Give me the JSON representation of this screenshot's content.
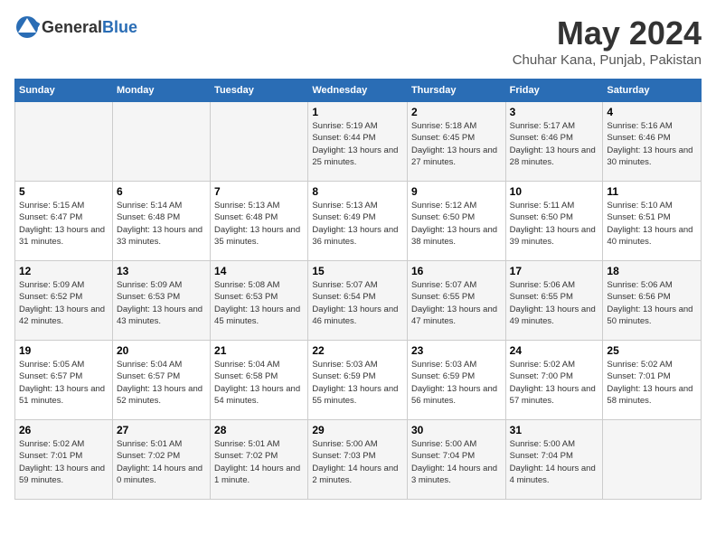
{
  "logo": {
    "general": "General",
    "blue": "Blue"
  },
  "header": {
    "month": "May 2024",
    "location": "Chuhar Kana, Punjab, Pakistan"
  },
  "weekdays": [
    "Sunday",
    "Monday",
    "Tuesday",
    "Wednesday",
    "Thursday",
    "Friday",
    "Saturday"
  ],
  "weeks": [
    [
      {
        "day": "",
        "sunrise": "",
        "sunset": "",
        "daylight": ""
      },
      {
        "day": "",
        "sunrise": "",
        "sunset": "",
        "daylight": ""
      },
      {
        "day": "",
        "sunrise": "",
        "sunset": "",
        "daylight": ""
      },
      {
        "day": "1",
        "sunrise": "Sunrise: 5:19 AM",
        "sunset": "Sunset: 6:44 PM",
        "daylight": "Daylight: 13 hours and 25 minutes."
      },
      {
        "day": "2",
        "sunrise": "Sunrise: 5:18 AM",
        "sunset": "Sunset: 6:45 PM",
        "daylight": "Daylight: 13 hours and 27 minutes."
      },
      {
        "day": "3",
        "sunrise": "Sunrise: 5:17 AM",
        "sunset": "Sunset: 6:46 PM",
        "daylight": "Daylight: 13 hours and 28 minutes."
      },
      {
        "day": "4",
        "sunrise": "Sunrise: 5:16 AM",
        "sunset": "Sunset: 6:46 PM",
        "daylight": "Daylight: 13 hours and 30 minutes."
      }
    ],
    [
      {
        "day": "5",
        "sunrise": "Sunrise: 5:15 AM",
        "sunset": "Sunset: 6:47 PM",
        "daylight": "Daylight: 13 hours and 31 minutes."
      },
      {
        "day": "6",
        "sunrise": "Sunrise: 5:14 AM",
        "sunset": "Sunset: 6:48 PM",
        "daylight": "Daylight: 13 hours and 33 minutes."
      },
      {
        "day": "7",
        "sunrise": "Sunrise: 5:13 AM",
        "sunset": "Sunset: 6:48 PM",
        "daylight": "Daylight: 13 hours and 35 minutes."
      },
      {
        "day": "8",
        "sunrise": "Sunrise: 5:13 AM",
        "sunset": "Sunset: 6:49 PM",
        "daylight": "Daylight: 13 hours and 36 minutes."
      },
      {
        "day": "9",
        "sunrise": "Sunrise: 5:12 AM",
        "sunset": "Sunset: 6:50 PM",
        "daylight": "Daylight: 13 hours and 38 minutes."
      },
      {
        "day": "10",
        "sunrise": "Sunrise: 5:11 AM",
        "sunset": "Sunset: 6:50 PM",
        "daylight": "Daylight: 13 hours and 39 minutes."
      },
      {
        "day": "11",
        "sunrise": "Sunrise: 5:10 AM",
        "sunset": "Sunset: 6:51 PM",
        "daylight": "Daylight: 13 hours and 40 minutes."
      }
    ],
    [
      {
        "day": "12",
        "sunrise": "Sunrise: 5:09 AM",
        "sunset": "Sunset: 6:52 PM",
        "daylight": "Daylight: 13 hours and 42 minutes."
      },
      {
        "day": "13",
        "sunrise": "Sunrise: 5:09 AM",
        "sunset": "Sunset: 6:53 PM",
        "daylight": "Daylight: 13 hours and 43 minutes."
      },
      {
        "day": "14",
        "sunrise": "Sunrise: 5:08 AM",
        "sunset": "Sunset: 6:53 PM",
        "daylight": "Daylight: 13 hours and 45 minutes."
      },
      {
        "day": "15",
        "sunrise": "Sunrise: 5:07 AM",
        "sunset": "Sunset: 6:54 PM",
        "daylight": "Daylight: 13 hours and 46 minutes."
      },
      {
        "day": "16",
        "sunrise": "Sunrise: 5:07 AM",
        "sunset": "Sunset: 6:55 PM",
        "daylight": "Daylight: 13 hours and 47 minutes."
      },
      {
        "day": "17",
        "sunrise": "Sunrise: 5:06 AM",
        "sunset": "Sunset: 6:55 PM",
        "daylight": "Daylight: 13 hours and 49 minutes."
      },
      {
        "day": "18",
        "sunrise": "Sunrise: 5:06 AM",
        "sunset": "Sunset: 6:56 PM",
        "daylight": "Daylight: 13 hours and 50 minutes."
      }
    ],
    [
      {
        "day": "19",
        "sunrise": "Sunrise: 5:05 AM",
        "sunset": "Sunset: 6:57 PM",
        "daylight": "Daylight: 13 hours and 51 minutes."
      },
      {
        "day": "20",
        "sunrise": "Sunrise: 5:04 AM",
        "sunset": "Sunset: 6:57 PM",
        "daylight": "Daylight: 13 hours and 52 minutes."
      },
      {
        "day": "21",
        "sunrise": "Sunrise: 5:04 AM",
        "sunset": "Sunset: 6:58 PM",
        "daylight": "Daylight: 13 hours and 54 minutes."
      },
      {
        "day": "22",
        "sunrise": "Sunrise: 5:03 AM",
        "sunset": "Sunset: 6:59 PM",
        "daylight": "Daylight: 13 hours and 55 minutes."
      },
      {
        "day": "23",
        "sunrise": "Sunrise: 5:03 AM",
        "sunset": "Sunset: 6:59 PM",
        "daylight": "Daylight: 13 hours and 56 minutes."
      },
      {
        "day": "24",
        "sunrise": "Sunrise: 5:02 AM",
        "sunset": "Sunset: 7:00 PM",
        "daylight": "Daylight: 13 hours and 57 minutes."
      },
      {
        "day": "25",
        "sunrise": "Sunrise: 5:02 AM",
        "sunset": "Sunset: 7:01 PM",
        "daylight": "Daylight: 13 hours and 58 minutes."
      }
    ],
    [
      {
        "day": "26",
        "sunrise": "Sunrise: 5:02 AM",
        "sunset": "Sunset: 7:01 PM",
        "daylight": "Daylight: 13 hours and 59 minutes."
      },
      {
        "day": "27",
        "sunrise": "Sunrise: 5:01 AM",
        "sunset": "Sunset: 7:02 PM",
        "daylight": "Daylight: 14 hours and 0 minutes."
      },
      {
        "day": "28",
        "sunrise": "Sunrise: 5:01 AM",
        "sunset": "Sunset: 7:02 PM",
        "daylight": "Daylight: 14 hours and 1 minute."
      },
      {
        "day": "29",
        "sunrise": "Sunrise: 5:00 AM",
        "sunset": "Sunset: 7:03 PM",
        "daylight": "Daylight: 14 hours and 2 minutes."
      },
      {
        "day": "30",
        "sunrise": "Sunrise: 5:00 AM",
        "sunset": "Sunset: 7:04 PM",
        "daylight": "Daylight: 14 hours and 3 minutes."
      },
      {
        "day": "31",
        "sunrise": "Sunrise: 5:00 AM",
        "sunset": "Sunset: 7:04 PM",
        "daylight": "Daylight: 14 hours and 4 minutes."
      },
      {
        "day": "",
        "sunrise": "",
        "sunset": "",
        "daylight": ""
      }
    ]
  ]
}
